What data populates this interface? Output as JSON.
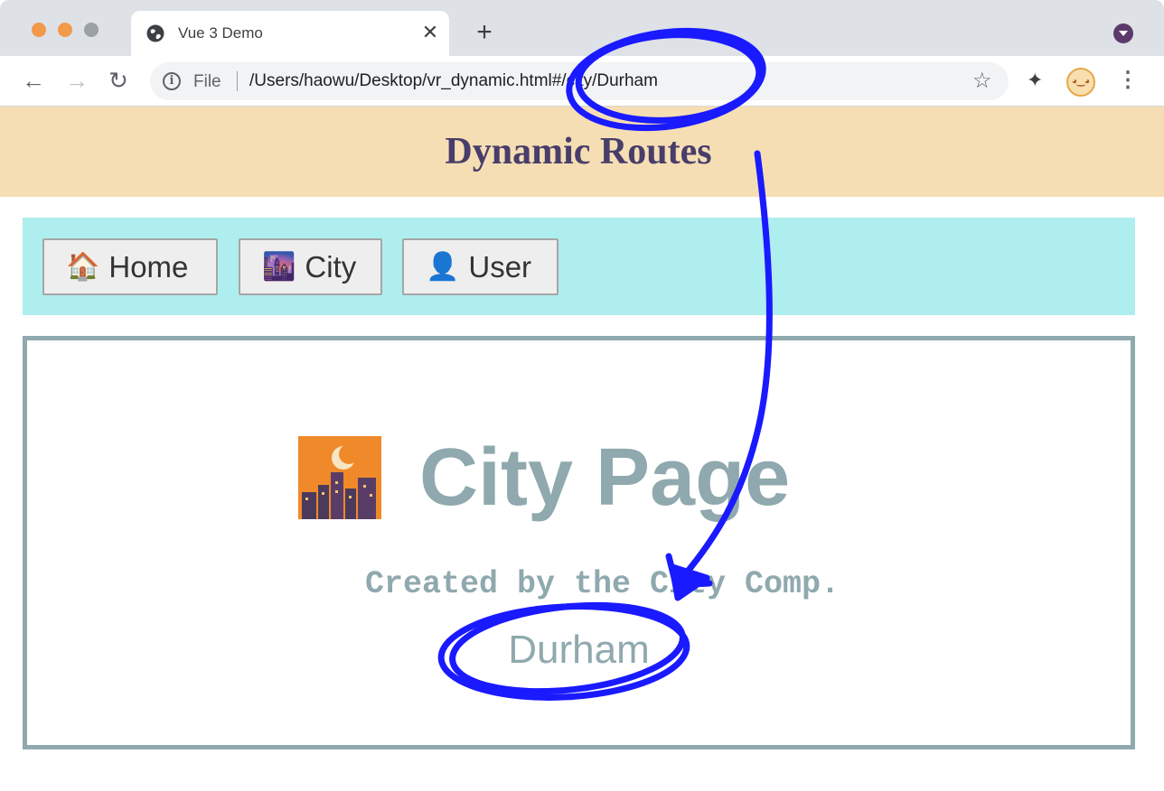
{
  "browser": {
    "tab_title": "Vue 3 Demo",
    "tab_close": "✕",
    "new_tab": "+",
    "file_label": "File",
    "url": "/Users/haowu/Desktop/vr_dynamic.html#/city/Durham"
  },
  "page": {
    "title": "Dynamic Routes",
    "nav": [
      {
        "icon": "🏠",
        "label": "Home"
      },
      {
        "icon": "🌆",
        "label": "City"
      },
      {
        "icon": "👤",
        "label": "User"
      }
    ],
    "content": {
      "heading": "City Page",
      "created_by": "Created by the City Comp.",
      "city_name": "Durham"
    }
  },
  "colors": {
    "header_bg": "#f5deb3",
    "nav_bg": "#afeeee",
    "content_text": "#8fa9ae",
    "title_text": "#483d6b",
    "annotation": "#1a1aff"
  },
  "icons": [
    "globe-icon",
    "close-icon",
    "plus-icon",
    "back-icon",
    "forward-icon",
    "reload-icon",
    "info-icon",
    "star-icon",
    "puzzle-icon",
    "menu-icon",
    "city-icon"
  ]
}
